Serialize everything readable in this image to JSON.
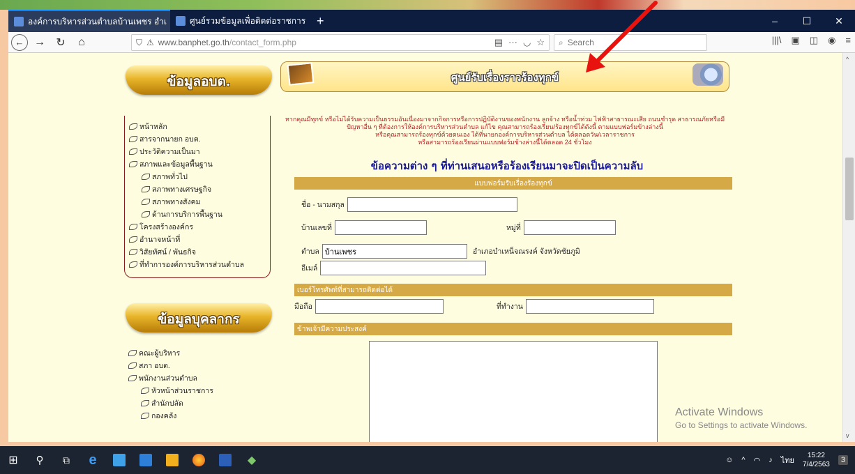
{
  "browser": {
    "tabs": [
      {
        "label": "องค์การบริหารส่วนตำบลบ้านเพชร อำเ",
        "active": true
      },
      {
        "label": "ศูนย์รวมข้อมูลเพื่อติดต่อราชการ",
        "active": false
      }
    ],
    "new_tab": "+",
    "url": "www.banphet.go.th/contact_form.php",
    "url_host": "www.banphet.go.th",
    "url_path": "/contact_form.php",
    "search_placeholder": "Search",
    "window_controls": [
      "–",
      "☐",
      "✕"
    ]
  },
  "sidebar": {
    "section1_title": "ข้อมูลอบต.",
    "section1_items": [
      {
        "label": "หน้าหลัก",
        "sub": false
      },
      {
        "label": "สารจากนายก อบต.",
        "sub": false
      },
      {
        "label": "ประวัติความเป็นมา",
        "sub": false
      },
      {
        "label": "สภาพและข้อมูลพื้นฐาน",
        "sub": false
      },
      {
        "label": "สภาพทั่วไป",
        "sub": true
      },
      {
        "label": "สภาพทางเศรษฐกิจ",
        "sub": true
      },
      {
        "label": "สภาพทางสังคม",
        "sub": true
      },
      {
        "label": "ด้านการบริการพื้นฐาน",
        "sub": true
      },
      {
        "label": "โครงสร้างองค์กร",
        "sub": false
      },
      {
        "label": "อำนาจหน้าที่",
        "sub": false
      },
      {
        "label": "วิสัยทัศน์ / พันธกิจ",
        "sub": false
      },
      {
        "label": "ที่ทำการองค์การบริหารส่วนตำบล",
        "sub": false
      }
    ],
    "section2_title": "ข้อมูลบุคลากร",
    "section2_items": [
      {
        "label": "คณะผู้บริหาร",
        "sub": false
      },
      {
        "label": "สภา อบต.",
        "sub": false
      },
      {
        "label": "พนักงานส่วนตำบล",
        "sub": false
      },
      {
        "label": "หัวหน้าส่วนราชการ",
        "sub": true
      },
      {
        "label": "สำนักปลัด",
        "sub": true
      },
      {
        "label": "กองคลัง",
        "sub": true
      }
    ]
  },
  "main": {
    "header_title": "ศูนย์รับเรื่องราวร้องทุกข์",
    "intro_lines": [
      "หากคุณมีทุกข์ หรือไม่ได้รับความเป็นธรรมอันเนื่องมาจากกิจการหรือการปฏิบัติงานของพนักงาน ลูกจ้าง หรือน้ำท่วม ไฟฟ้าสาธารณะเสีย ถนนชำรุด สาธารณภัยหรือมี",
      "ปัญหาอื่น ๆ ที่ต้องการให้องค์การบริหารส่วนตำบล แก้ไข คุณสามารถร้องเรียน/ร้องทุกข์ได้ดังนี้ ตามแบบฟอร์มข้างล่างนี้",
      "หรือคุณสามารถร้องทุกข์ด้วยตนเอง ได้ที่นายกองค์การบริหารส่วนตำบล ได้ตลอดวัน/เวลาราชการ",
      "หรือสามารถร้องเรียนผ่านแบบฟอร์มข้างล่างนี้ได้ตลอด 24 ชั่วโมง"
    ],
    "subhead": "ข้อความต่าง ๆ ที่ท่านเสนอหรือร้องเรียนมาจะปิดเป็นความลับ",
    "form": {
      "section_title": "แบบฟอร์มรับเรื่องร้องทุกข์",
      "name_label": "ชื่อ - นามสกุล",
      "name_value": "",
      "house_label": "บ้านเลขที่",
      "house_value": "",
      "moo_label": "หมู่ที่",
      "moo_value": "",
      "tambon_label": "ตำบล",
      "tambon_value": "บ้านเพชร",
      "amphoe_text": "อำเภอบำเหน็จณรงค์ จังหวัดชัยภูมิ",
      "email_label": "อีเมล์",
      "email_value": "",
      "phone_section": "เบอร์โทรศัพท์ที่สามารถติดต่อได้",
      "mobile_label": "มือถือ",
      "mobile_value": "",
      "work_label": "ที่ทำงาน",
      "work_value": "",
      "purpose_section": "ข้าพเจ้ามีความประสงค์",
      "purpose_value": ""
    }
  },
  "overlay": {
    "activate_title": "Activate Windows",
    "activate_sub": "Go to Settings to activate Windows."
  },
  "taskbar": {
    "tray_lang": "ไทย",
    "time": "15:22",
    "date": "7/4/2563",
    "notifications": "3"
  }
}
